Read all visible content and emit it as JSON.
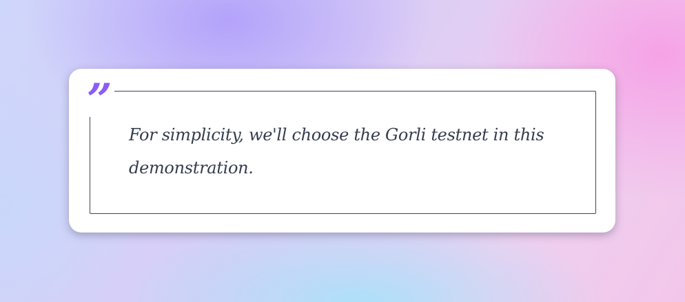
{
  "quote": {
    "mark": "”",
    "text": "For simplicity, we'll choose the Gorli testnet in this demonstration."
  },
  "colors": {
    "accent": "#8b5cf6",
    "text": "#353c4e",
    "border": "#3a4356"
  }
}
